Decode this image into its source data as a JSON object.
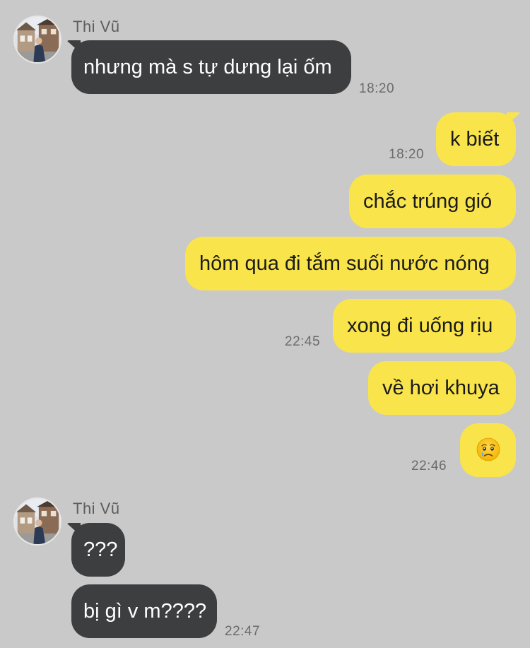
{
  "chat": {
    "groups": [
      {
        "sender": "Thi Vũ",
        "messages": [
          {
            "text": "nhưng mà s tự dưng lại ốm",
            "time": "18:20"
          }
        ]
      },
      {
        "sender": "me",
        "messages": [
          {
            "text": "k biết",
            "time": "18:20"
          },
          {
            "text": "chắc trúng gió"
          },
          {
            "text": "hôm qua đi tắm suối nước nóng"
          },
          {
            "text": "xong đi uống rịu",
            "time": "22:45"
          },
          {
            "text": "về hơi khuya"
          },
          {
            "emoji": "face-holding-back-tears",
            "time": "22:46"
          }
        ]
      },
      {
        "sender": "Thi Vũ",
        "messages": [
          {
            "text": "???"
          },
          {
            "text": "bị gì v m????",
            "time": "22:47"
          }
        ]
      }
    ]
  },
  "colors": {
    "background": "#c9c9c9",
    "incoming_bubble": "#3d3e40",
    "outgoing_bubble": "#f9e54b"
  }
}
